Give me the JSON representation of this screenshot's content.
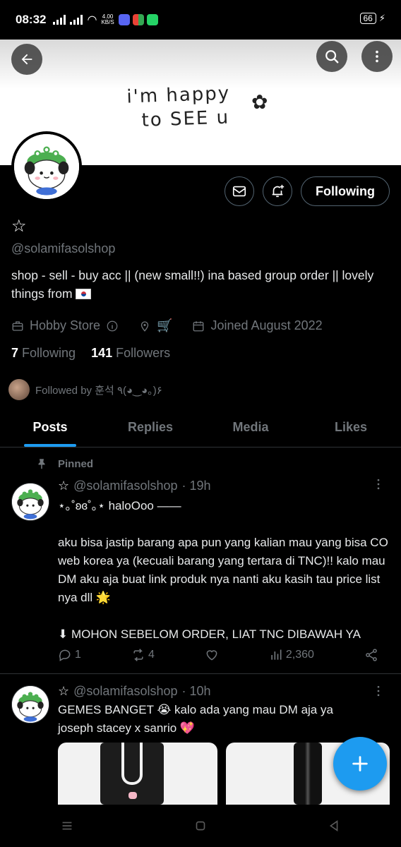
{
  "status_bar": {
    "time": "08:32",
    "net_speed_value": "4.00",
    "net_speed_unit": "KB/S",
    "battery": "66"
  },
  "banner": {
    "line1": "i'm happy",
    "line2": "to SEE u"
  },
  "profile": {
    "name": "☆",
    "handle": "@solamifasolshop",
    "bio": "shop - sell - buy acc || (new small!!) ina based group order || lovely things from",
    "category": "Hobby Store",
    "location_emoji": "🛒",
    "joined": "Joined August 2022",
    "following_count": "7",
    "following_label": "Following",
    "followers_count": "141",
    "followers_label": "Followers",
    "followed_by": "Followed by 훈석 ٩(◕‿◕｡)۶",
    "follow_button": "Following"
  },
  "tabs": [
    "Posts",
    "Replies",
    "Media",
    "Likes"
  ],
  "tweets": [
    {
      "pinned_label": "Pinned",
      "name": "☆",
      "handle": "@solamifasolshop",
      "time": "· 19h",
      "line1": "⋆｡˚ʚɞ˚｡⋆ haloOoo ——",
      "line2": "aku bisa jastip barang apa pun yang kalian mau yang bisa CO web korea ya (kecuali barang yang tertara di TNC)!! kalo mau DM aku aja buat link produk nya nanti aku kasih tau price list nya dll 🌟",
      "line3": "⬇ MOHON SEBELOM ORDER, LIAT TNC DIBAWAH YA",
      "replies": "1",
      "retweets": "4",
      "views": "2,360"
    },
    {
      "name": "☆",
      "handle": "@solamifasolshop",
      "time": "· 10h",
      "line1": "GEMES BANGET 😭 kalo ada yang mau DM aja ya",
      "line2": "joseph stacey x sanrio 💖"
    }
  ],
  "colors": {
    "accent": "#1d9bf0",
    "muted": "#71767b",
    "border": "#2f3336",
    "text": "#e7e9ea"
  }
}
